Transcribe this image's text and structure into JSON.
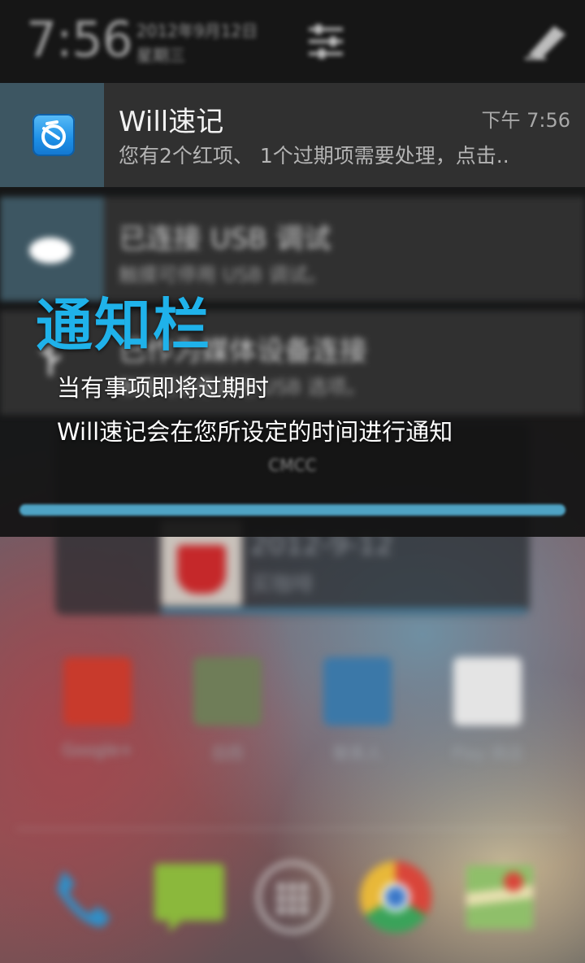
{
  "status_bar": {
    "time": "7:56",
    "date": "2012年9月12日",
    "weekday": "星期三"
  },
  "notifications": [
    {
      "app": "Will速记",
      "time": "下午 7:56",
      "text": "您有2个红项、 1个过期项需要处理，点击..",
      "icon": "will-app-icon"
    },
    {
      "title": "已连接 USB 调试",
      "text": "触摸可停用 USB 调试。",
      "icon": "usb-debug-icon"
    },
    {
      "title": "已作为媒体设备连接",
      "text": "触摸可查看其他 USB 选项。",
      "icon": "usb-icon"
    }
  ],
  "carrier": "CMCC",
  "caption": {
    "title": "通知栏",
    "line1": "当有事项即将过期时",
    "line2": "Will速记会在您所设定的时间进行通知"
  },
  "home": {
    "widget": {
      "date": "2012-9-12",
      "subtitle": "买咖啡"
    },
    "apps": [
      {
        "label": "Google+",
        "icon": "google-plus-icon",
        "color": "#c83a2c"
      },
      {
        "label": "日历",
        "icon": "calendar-icon",
        "color": "#6f7d58"
      },
      {
        "label": "联系人",
        "icon": "contacts-icon",
        "color": "#3b78a8"
      },
      {
        "label": "Play 商店",
        "icon": "play-store-icon",
        "color": "#e4e4e4"
      }
    ],
    "dock": [
      {
        "icon": "phone-icon",
        "color": "#2f8fc8"
      },
      {
        "icon": "messaging-icon",
        "color": "#8bb83c"
      },
      {
        "icon": "all-apps-icon",
        "color": "#d8d8d8"
      },
      {
        "icon": "chrome-icon",
        "color": "#d9453a"
      },
      {
        "icon": "maps-icon",
        "color": "#8fbf6a"
      }
    ]
  }
}
